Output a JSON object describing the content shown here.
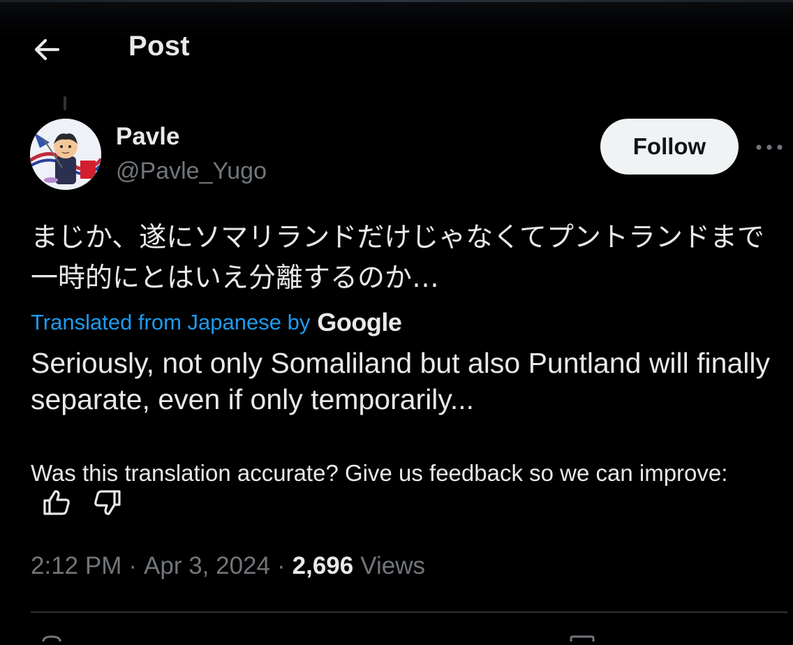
{
  "header": {
    "title": "Post",
    "back_icon": "arrow-left-icon"
  },
  "post": {
    "author": {
      "display_name": "Pavle",
      "handle": "@Pavle_Yugo"
    },
    "follow_label": "Follow",
    "more_icon": "more-horizontal-icon",
    "original_text": "まじか、遂にソマリランドだけじゃなくてプントランドまで一時的にとはいえ分離するのか…",
    "translation_label": "Translated from Japanese by",
    "translation_provider": "Google",
    "translated_text": "Seriously, not only Somaliland but also Puntland will finally separate, even if only temporarily...",
    "feedback_prompt": "Was this translation accurate? Give us feedback so we can improve:",
    "time": "2:12 PM",
    "date": "Apr 3, 2024",
    "views_count": "2,696",
    "views_label": "Views"
  },
  "colors": {
    "background": "#000000",
    "text_primary": "#e7e9ea",
    "text_secondary": "#71767b",
    "link": "#1d9bf0",
    "follow_bg": "#eff3f4",
    "divider": "#2f3336"
  }
}
